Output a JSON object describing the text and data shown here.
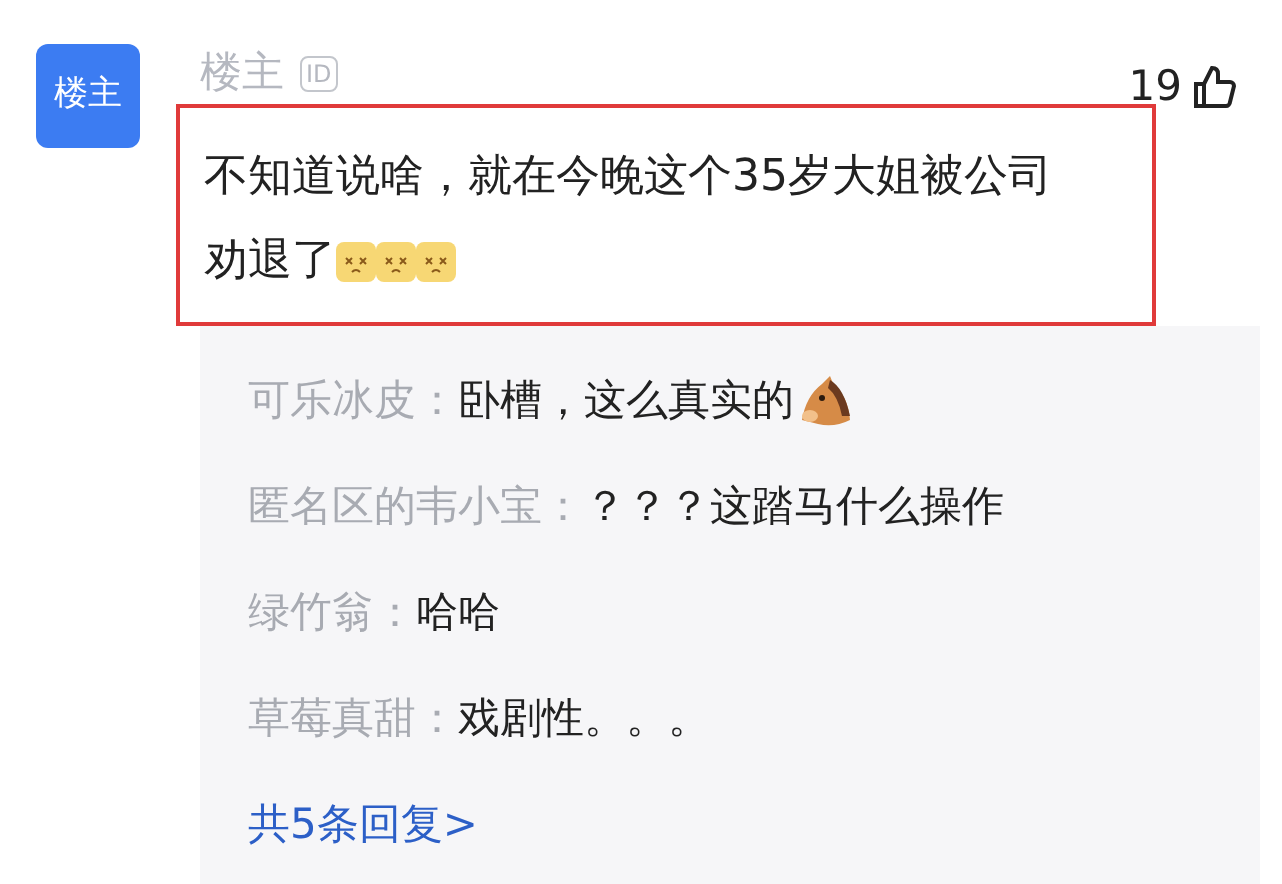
{
  "comment": {
    "avatar_text": "楼主",
    "author": "楼主",
    "badge": "ID",
    "likes": "19",
    "text": "不知道说啥，就在今晚这个35岁大姐被公司劝退了",
    "emojis": [
      {
        "kind": "dizzy-face"
      },
      {
        "kind": "dizzy-face"
      },
      {
        "kind": "dizzy-face"
      }
    ],
    "highlighted": true
  },
  "replies": [
    {
      "author": "可乐冰皮：",
      "text": "卧槽，这么真实的",
      "emojis": [
        {
          "kind": "horse"
        }
      ]
    },
    {
      "author": "匿名区的韦小宝：",
      "text": "？？？这踏马什么操作"
    },
    {
      "author": "绿竹翁：",
      "text": "哈哈"
    },
    {
      "author": "草莓真甜：",
      "text": "戏剧性。。。"
    }
  ],
  "more_link": "共5条回复>"
}
